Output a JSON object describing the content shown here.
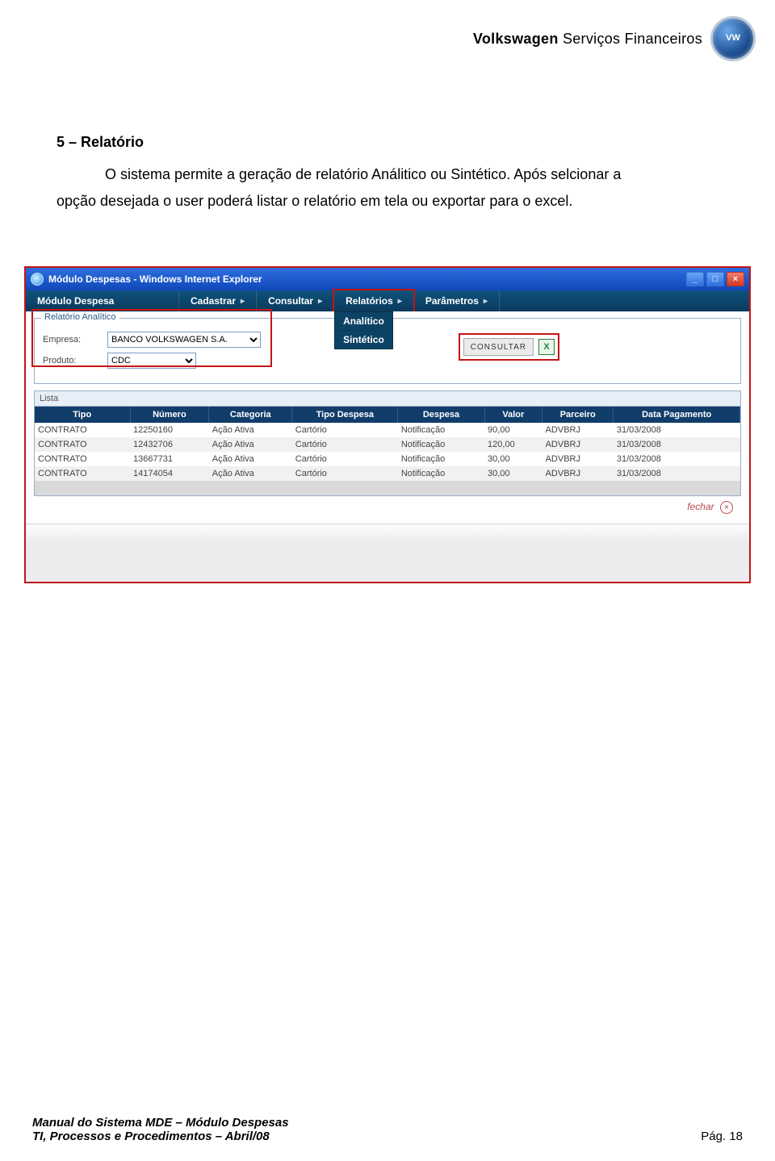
{
  "header": {
    "brand_bold": "Volkswagen",
    "brand_thin": "Serviços Financeiros",
    "logo_text": "VW"
  },
  "section": {
    "title": "5 – Relatório",
    "body_lead": "O sistema permite a geração de relatório Análitico ou Sintético. Após selcionar a",
    "body_rest": "opção desejada o user poderá listar o relatório em tela ou exportar para o excel."
  },
  "window": {
    "title": "Módulo Despesas - Windows Internet Explorer"
  },
  "menu": {
    "items": [
      "Módulo Despesa",
      "Cadastrar",
      "Consultar",
      "Relatórios",
      "Parâmetros"
    ],
    "dropdown": {
      "items": [
        "Analítico",
        "Sintético"
      ]
    }
  },
  "form": {
    "legend": "Relatório Analítico",
    "empresa_label": "Empresa:",
    "empresa_value": "BANCO VOLKSWAGEN S.A.",
    "produto_label": "Produto:",
    "produto_value": "CDC",
    "consultar_label": "CONSULTAR",
    "excel_glyph": "X"
  },
  "lista": {
    "caption": "Lista",
    "columns": [
      "Tipo",
      "Número",
      "Categoria",
      "Tipo Despesa",
      "Despesa",
      "Valor",
      "Parceiro",
      "Data Pagamento"
    ],
    "rows": [
      [
        "CONTRATO",
        "12250160",
        "Ação Ativa",
        "Cartório",
        "Notificação",
        "90,00",
        "ADVBRJ",
        "31/03/2008"
      ],
      [
        "CONTRATO",
        "12432706",
        "Ação Ativa",
        "Cartório",
        "Notificação",
        "120,00",
        "ADVBRJ",
        "31/03/2008"
      ],
      [
        "CONTRATO",
        "13667731",
        "Ação Ativa",
        "Cartório",
        "Notificação",
        "30,00",
        "ADVBRJ",
        "31/03/2008"
      ],
      [
        "CONTRATO",
        "14174054",
        "Ação Ativa",
        "Cartório",
        "Notificação",
        "30,00",
        "ADVBRJ",
        "31/03/2008"
      ]
    ],
    "close_label": "fechar"
  },
  "footer": {
    "line1": "Manual do Sistema MDE – Módulo Despesas",
    "line2": "TI, Processos e Procedimentos  – Abril/08",
    "page": "Pág. 18"
  }
}
